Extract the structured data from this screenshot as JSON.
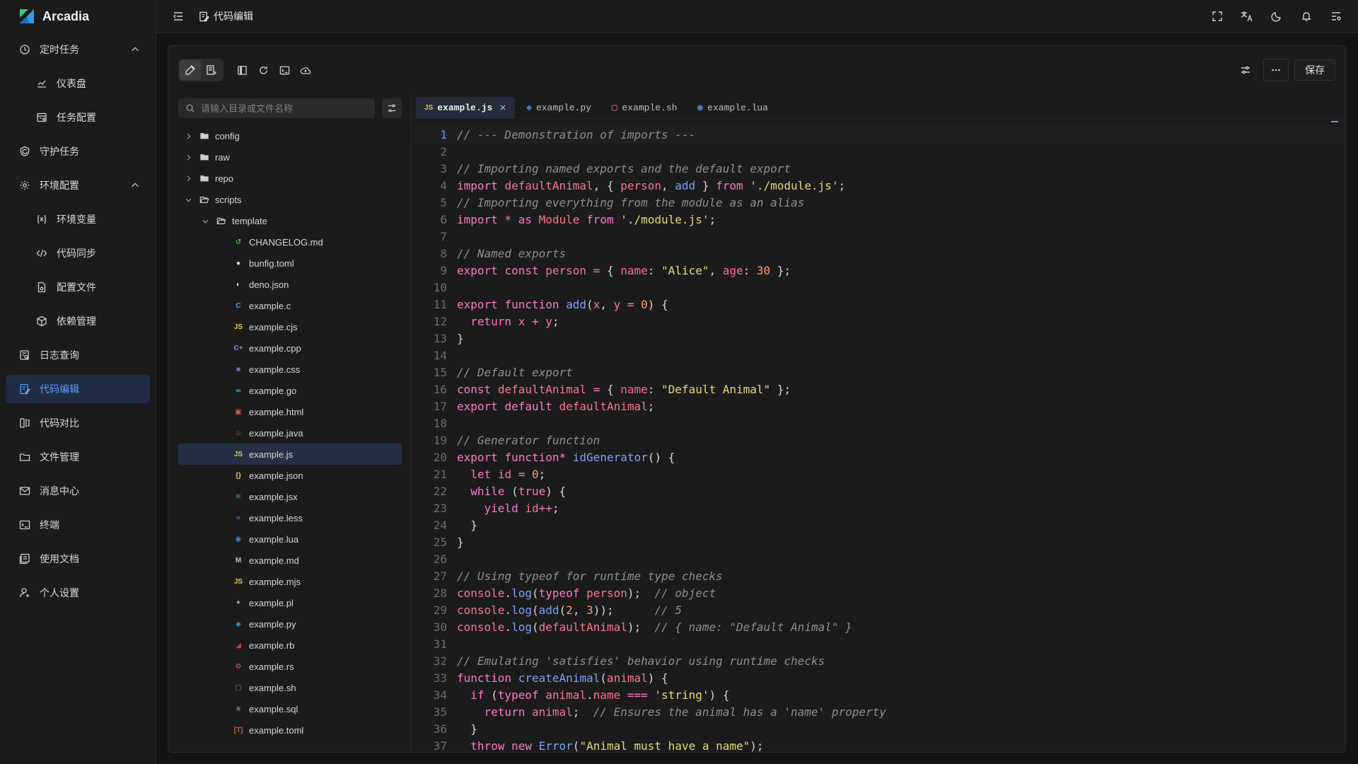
{
  "app": {
    "name": "Arcadia"
  },
  "colors": {
    "accent": "#5b9dff",
    "active_bg": "#1f2c44",
    "bg": "#141414"
  },
  "sidebar": {
    "items": [
      {
        "label": "定时任务",
        "icon": "clock-icon",
        "level": "top",
        "expanded": true
      },
      {
        "label": "仪表盘",
        "icon": "chart-line-icon",
        "level": "sub"
      },
      {
        "label": "任务配置",
        "icon": "config-icon",
        "level": "sub"
      },
      {
        "label": "守护任务",
        "icon": "shield-icon",
        "level": "top"
      },
      {
        "label": "环境配置",
        "icon": "gear-icon",
        "level": "top",
        "expanded": true
      },
      {
        "label": "环境变量",
        "icon": "variable-icon",
        "level": "sub"
      },
      {
        "label": "代码同步",
        "icon": "code-sync-icon",
        "level": "sub"
      },
      {
        "label": "配置文件",
        "icon": "file-config-icon",
        "level": "sub"
      },
      {
        "label": "依赖管理",
        "icon": "package-icon",
        "level": "sub"
      },
      {
        "label": "日志查询",
        "icon": "log-search-icon",
        "level": "top"
      },
      {
        "label": "代码编辑",
        "icon": "code-edit-icon",
        "level": "top",
        "active": true
      },
      {
        "label": "代码对比",
        "icon": "diff-icon",
        "level": "top"
      },
      {
        "label": "文件管理",
        "icon": "folder-icon",
        "level": "top"
      },
      {
        "label": "消息中心",
        "icon": "mail-icon",
        "level": "top"
      },
      {
        "label": "终端",
        "icon": "terminal-icon",
        "level": "top"
      },
      {
        "label": "使用文档",
        "icon": "docs-icon",
        "level": "top"
      },
      {
        "label": "个人设置",
        "icon": "user-settings-icon",
        "level": "top"
      }
    ]
  },
  "topbar": {
    "breadcrumb": "代码编辑"
  },
  "toolbar": {
    "save_label": "保存"
  },
  "tree": {
    "search_placeholder": "请输入目录或文件名称",
    "items": [
      {
        "name": "config",
        "type": "folder",
        "depth": 0,
        "expanded": false
      },
      {
        "name": "raw",
        "type": "folder",
        "depth": 0,
        "expanded": false
      },
      {
        "name": "repo",
        "type": "folder",
        "depth": 0,
        "expanded": false
      },
      {
        "name": "scripts",
        "type": "folder",
        "depth": 0,
        "expanded": true
      },
      {
        "name": "template",
        "type": "folder",
        "depth": 1,
        "expanded": true
      },
      {
        "name": "CHANGELOG.md",
        "type": "file",
        "depth": 2,
        "icon": "changelog-icon",
        "glyph": "↺",
        "color": "#5fb35f"
      },
      {
        "name": "bunfig.toml",
        "type": "file",
        "depth": 2,
        "icon": "bun-icon",
        "glyph": "●",
        "color": "#f3e6d3"
      },
      {
        "name": "deno.json",
        "type": "file",
        "depth": 2,
        "icon": "deno-icon",
        "glyph": "◐",
        "color": "#e0e0e0"
      },
      {
        "name": "example.c",
        "type": "file",
        "depth": 2,
        "icon": "c-icon",
        "glyph": "C",
        "color": "#5b9dff"
      },
      {
        "name": "example.cjs",
        "type": "file",
        "depth": 2,
        "icon": "js-icon",
        "glyph": "JS",
        "color": "#e6c84a"
      },
      {
        "name": "example.cpp",
        "type": "file",
        "depth": 2,
        "icon": "cpp-icon",
        "glyph": "C+",
        "color": "#b070d0"
      },
      {
        "name": "example.css",
        "type": "file",
        "depth": 2,
        "icon": "css-icon",
        "glyph": "■",
        "color": "#8a5bd6"
      },
      {
        "name": "example.go",
        "type": "file",
        "depth": 2,
        "icon": "go-icon",
        "glyph": "∞",
        "color": "#49b6e0"
      },
      {
        "name": "example.html",
        "type": "file",
        "depth": 2,
        "icon": "html-icon",
        "glyph": "▣",
        "color": "#e2572f"
      },
      {
        "name": "example.java",
        "type": "file",
        "depth": 2,
        "icon": "java-icon",
        "glyph": "♨",
        "color": "#e07b38"
      },
      {
        "name": "example.js",
        "type": "file",
        "depth": 2,
        "icon": "js-icon",
        "glyph": "JS",
        "color": "#e6c84a",
        "selected": true
      },
      {
        "name": "example.json",
        "type": "file",
        "depth": 2,
        "icon": "json-icon",
        "glyph": "{}",
        "color": "#e6c84a"
      },
      {
        "name": "example.jsx",
        "type": "file",
        "depth": 2,
        "icon": "react-icon",
        "glyph": "⚛",
        "color": "#4fc3f7"
      },
      {
        "name": "example.less",
        "type": "file",
        "depth": 2,
        "icon": "less-icon",
        "glyph": "≈",
        "color": "#4a76b8"
      },
      {
        "name": "example.lua",
        "type": "file",
        "depth": 2,
        "icon": "lua-icon",
        "glyph": "◉",
        "color": "#4e7ae0"
      },
      {
        "name": "example.md",
        "type": "file",
        "depth": 2,
        "icon": "markdown-icon",
        "glyph": "M",
        "color": "#bdbdbd"
      },
      {
        "name": "example.mjs",
        "type": "file",
        "depth": 2,
        "icon": "js-icon",
        "glyph": "JS",
        "color": "#e6c84a"
      },
      {
        "name": "example.pl",
        "type": "file",
        "depth": 2,
        "icon": "perl-icon",
        "glyph": "✦",
        "color": "#9da5b4"
      },
      {
        "name": "example.py",
        "type": "file",
        "depth": 2,
        "icon": "python-icon",
        "glyph": "◆",
        "color": "#3f7cc0"
      },
      {
        "name": "example.rb",
        "type": "file",
        "depth": 2,
        "icon": "ruby-icon",
        "glyph": "◢",
        "color": "#d33a2c"
      },
      {
        "name": "example.rs",
        "type": "file",
        "depth": 2,
        "icon": "rust-icon",
        "glyph": "⚙",
        "color": "#e0603a"
      },
      {
        "name": "example.sh",
        "type": "file",
        "depth": 2,
        "icon": "shell-icon",
        "glyph": "▢",
        "color": "#c0558a"
      },
      {
        "name": "example.sql",
        "type": "file",
        "depth": 2,
        "icon": "sql-icon",
        "glyph": "≡",
        "color": "#e6b43a"
      },
      {
        "name": "example.toml",
        "type": "file",
        "depth": 2,
        "icon": "toml-icon",
        "glyph": "[T]",
        "color": "#c0603a"
      }
    ]
  },
  "editor": {
    "tabs": [
      {
        "name": "example.js",
        "icon": "js-icon",
        "glyph": "JS",
        "color": "#e6c84a",
        "active": true
      },
      {
        "name": "example.py",
        "icon": "python-icon",
        "glyph": "◆",
        "color": "#3f7cc0"
      },
      {
        "name": "example.sh",
        "icon": "shell-icon",
        "glyph": "▢",
        "color": "#c0558a"
      },
      {
        "name": "example.lua",
        "icon": "lua-icon",
        "glyph": "◉",
        "color": "#4e7ae0"
      }
    ],
    "current_line": 1,
    "lines": [
      "// --- Demonstration of imports ---",
      "",
      "// Importing named exports and the default export",
      "import defaultAnimal, { person, add } from './module.js';",
      "// Importing everything from the module as an alias",
      "import * as Module from './module.js';",
      "",
      "// Named exports",
      "export const person = { name: \"Alice\", age: 30 };",
      "",
      "export function add(x, y = 0) {",
      "  return x + y;",
      "}",
      "",
      "// Default export",
      "const defaultAnimal = { name: \"Default Animal\" };",
      "export default defaultAnimal;",
      "",
      "// Generator function",
      "export function* idGenerator() {",
      "  let id = 0;",
      "  while (true) {",
      "    yield id++;",
      "  }",
      "}",
      "",
      "// Using typeof for runtime type checks",
      "console.log(typeof person);  // object",
      "console.log(add(2, 3));      // 5",
      "console.log(defaultAnimal);  // { name: \"Default Animal\" }",
      "",
      "// Emulating 'satisfies' behavior using runtime checks",
      "function createAnimal(animal) {",
      "  if (typeof animal.name === 'string') {",
      "    return animal;  // Ensures the animal has a 'name' property",
      "  }",
      "  throw new Error(\"Animal must have a name\");"
    ]
  }
}
